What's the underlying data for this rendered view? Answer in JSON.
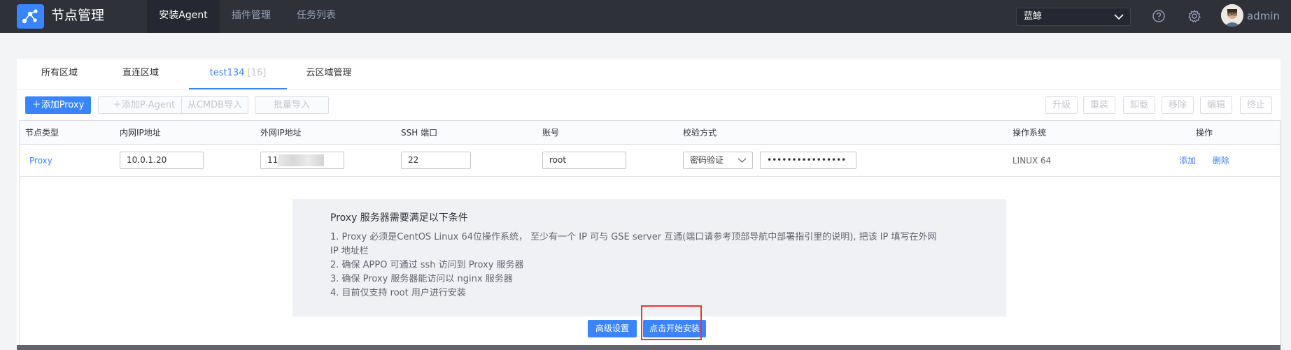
{
  "header": {
    "app_title": "节点管理",
    "nav": [
      "安装Agent",
      "插件管理",
      "任务列表"
    ],
    "business_select": "蓝鲸",
    "user": "admin",
    "icons": [
      "logo-icon",
      "help-icon",
      "gear-icon",
      "avatar"
    ],
    "accent": "#3a84ff"
  },
  "tabs": [
    {
      "label": "所有区域",
      "count": ""
    },
    {
      "label": "直连区域",
      "count": ""
    },
    {
      "label": "test134",
      "count": "[16]"
    },
    {
      "label": "云区域管理",
      "count": ""
    }
  ],
  "toolbar": {
    "add_proxy": "＋添加Proxy",
    "add_pagent": "＋添加P-Agent",
    "import_cmdb": "从CMDB导入",
    "batch_import": "批量导入",
    "right": [
      "升级",
      "重装",
      "卸载",
      "移除",
      "编辑",
      "终止"
    ]
  },
  "table": {
    "headers": [
      "节点类型",
      "内网IP地址",
      "外网IP地址",
      "SSH 端口",
      "账号",
      "校验方式",
      "操作系统",
      "操作"
    ],
    "row": {
      "node_type": "Proxy",
      "inner_ip": "10.0.1.20",
      "outer_ip": "11",
      "ssh_port": "22",
      "account": "root",
      "auth_type": "密码验证",
      "password": "••••••••••••••••",
      "os": "LINUX 64",
      "actions": [
        "添加",
        "删除"
      ]
    }
  },
  "notice": {
    "title": "Proxy 服务器需要满足以下条件",
    "items": [
      "1. Proxy 必须是CentOS Linux 64位操作系统， 至少有一个 IP 可与 GSE server 互通(端口请参考顶部导航中部署指引里的说明), 把该 IP 填写在外网",
      "IP 地址栏",
      "2. 确保 APPO 可通过 ssh 访问到 Proxy 服务器",
      "3. 确保 Proxy 服务器能访问以 nginx 服务器",
      "4. 目前仅支持 root 用户进行安装"
    ]
  },
  "footer": {
    "advanced": "高级设置",
    "start_install": "点击开始安装"
  }
}
